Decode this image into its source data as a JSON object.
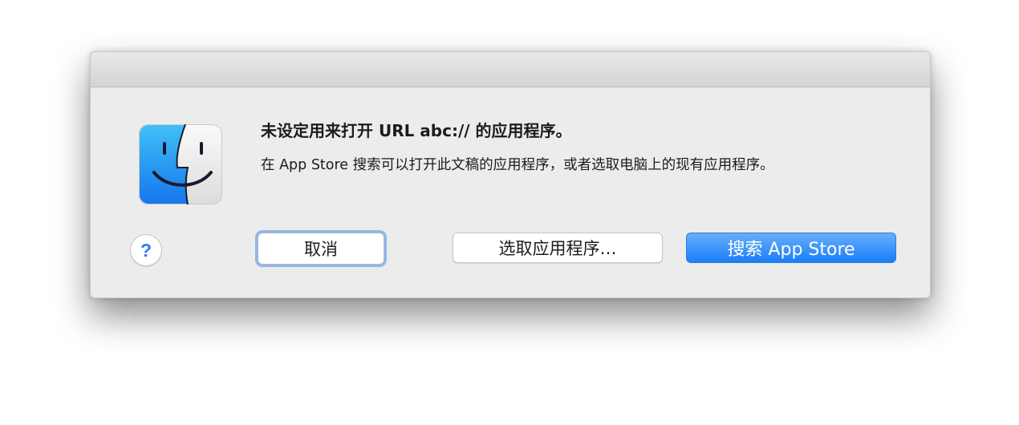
{
  "dialog": {
    "headline": "未设定用来打开 URL abc:// 的应用程序。",
    "message": "在 App Store 搜索可以打开此文稿的应用程序，或者选取电脑上的现有应用程序。",
    "icon": "finder-icon",
    "help_label": "?",
    "buttons": {
      "cancel": "取消",
      "choose": "选取应用程序…",
      "search": "搜索 App Store"
    }
  },
  "colors": {
    "accent": "#1a7ef6",
    "focus_ring": "#8fb7ef",
    "background": "#ececec"
  }
}
